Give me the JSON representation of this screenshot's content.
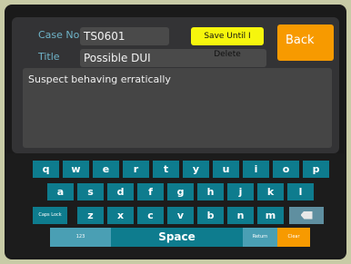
{
  "form": {
    "case_no_label": "Case No.",
    "case_no_value": "TS0601",
    "title_label": "Title",
    "title_value": "Possible DUI",
    "notes_value": "Suspect behaving erratically",
    "save_label": "Save Until I Delete",
    "back_label": "Back"
  },
  "keyboard": {
    "row1": [
      "q",
      "w",
      "e",
      "r",
      "t",
      "y",
      "u",
      "i",
      "o",
      "p"
    ],
    "row2": [
      "a",
      "s",
      "d",
      "f",
      "g",
      "h",
      "j",
      "k",
      "l"
    ],
    "row3": [
      "z",
      "x",
      "c",
      "v",
      "b",
      "n",
      "m"
    ],
    "caps_label": "Caps Lock",
    "backspace_icon": "backspace-icon",
    "num_label": "123",
    "space_label": "Space",
    "return_label": "Return",
    "clear_label": "Clear"
  }
}
